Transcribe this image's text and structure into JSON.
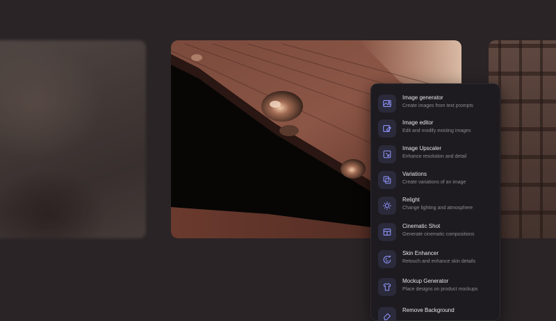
{
  "colors": {
    "background": "#2a2426",
    "panel": "#1d1b1f",
    "icon_bg": "#2a2a3a",
    "icon_stroke": "#8a8ef0",
    "title_text": "#e8e6ea",
    "desc_text": "#8e8b92"
  },
  "gallery": {
    "left_image": "blurred-portrait",
    "center_image": "water-droplets-on-wood",
    "right_image": "brick-building-facade"
  },
  "menu": {
    "items": [
      {
        "title": "Image generator",
        "desc": "Create images from text prompts",
        "icon": "image-plus-icon"
      },
      {
        "title": "Image editor",
        "desc": "Edit and modify existing images",
        "icon": "image-edit-icon"
      },
      {
        "title": "Image Upscaler",
        "desc": "Enhance resolution and detail",
        "icon": "upscale-icon"
      },
      {
        "title": "Variations",
        "desc": "Create variations of an image",
        "icon": "copy-icon"
      },
      {
        "title": "Relight",
        "desc": "Change lighting and atmosphere",
        "icon": "sun-icon"
      },
      {
        "title": "Cinematic Shot",
        "desc": "Generate cinematic compositions",
        "icon": "film-icon"
      },
      {
        "title": "Skin Enhancer",
        "desc": "Retouch and enhance skin details",
        "icon": "face-sparkle-icon"
      },
      {
        "title": "Mockup Generator",
        "desc": "Place designs on product mockups",
        "icon": "shirt-icon"
      },
      {
        "title": "Remove Background",
        "desc": "",
        "icon": "eraser-icon"
      }
    ]
  }
}
